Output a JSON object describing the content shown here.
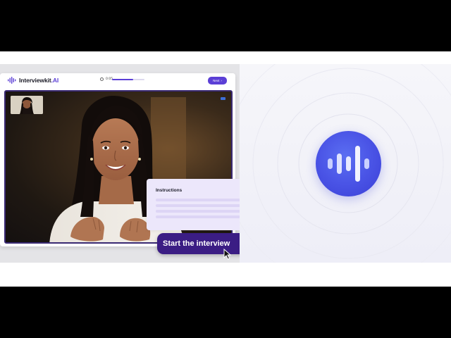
{
  "app": {
    "brand_name": "Interviewkit",
    "brand_suffix": ".AI",
    "timer": "0:05",
    "progress": 0.65,
    "next_label": "Next",
    "next_arrow": "›"
  },
  "instructions": {
    "title": "Instructions"
  },
  "start_button": {
    "label": "Start the interview"
  },
  "colors": {
    "accent": "#5b3fd6",
    "start_button": "#3b1d84",
    "orb": "#4a54e6"
  },
  "icons": {
    "brand": "soundwave-icon",
    "timer": "clock-icon",
    "voice": "voice-wave-icon",
    "cursor": "mouse-pointer-icon"
  }
}
